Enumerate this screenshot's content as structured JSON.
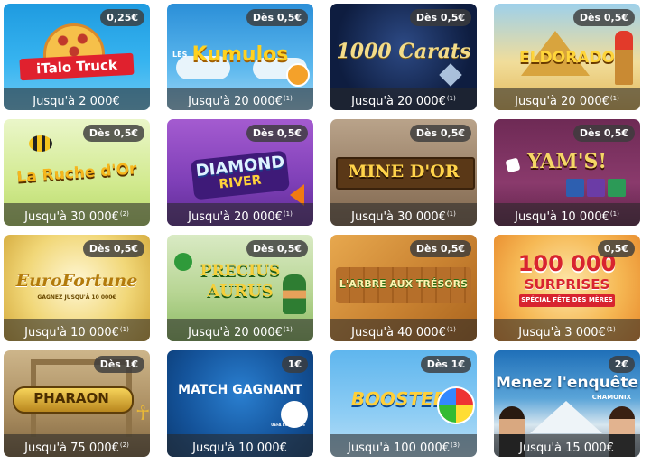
{
  "cards": [
    {
      "name": "Italo Truck",
      "logo": "iTalo Truck",
      "price": "0,25€",
      "max_win": "Jusqu'à 2 000€",
      "note": ""
    },
    {
      "name": "Les Kumulos",
      "logo": "Kumulos",
      "logo_prefix": "LES",
      "price": "Dès 0,5€",
      "max_win": "Jusqu'à 20 000€",
      "note": "(1)"
    },
    {
      "name": "1000 Carats",
      "logo": "1000 Carats",
      "price": "Dès 0,5€",
      "max_win": "Jusqu'à 20 000€",
      "note": "(1)"
    },
    {
      "name": "Eldorado",
      "logo": "ELDORADO",
      "price": "Dès 0,5€",
      "max_win": "Jusqu'à 20 000€",
      "note": "(1)"
    },
    {
      "name": "La Ruche d'Or",
      "logo": "La Ruche d'Or",
      "price": "Dès 0,5€",
      "max_win": "Jusqu'à 30 000€",
      "note": "(2)"
    },
    {
      "name": "Diamond River",
      "logo": "DIAMOND",
      "logo_sub": "RIVER",
      "price": "Dès 0,5€",
      "max_win": "Jusqu'à 20 000€",
      "note": "(1)"
    },
    {
      "name": "Mine d'Or",
      "logo": "MINE D'OR",
      "price": "Dès 0,5€",
      "max_win": "Jusqu'à 30 000€",
      "note": "(1)"
    },
    {
      "name": "Yam's",
      "logo": "YAM'S!",
      "price": "Dès 0,5€",
      "max_win": "Jusqu'à 10 000€",
      "note": "(1)"
    },
    {
      "name": "EuroFortune",
      "logo": "EuroFortune",
      "logo_sub": "GAGNEZ JUSQU'À 10 000€",
      "price": "Dès 0,5€",
      "max_win": "Jusqu'à 10 000€",
      "note": "(1)"
    },
    {
      "name": "Precius Aurus",
      "logo": "PRECIUS",
      "logo_sub": "AURUS",
      "price": "Dès 0,5€",
      "max_win": "Jusqu'à 20 000€",
      "note": "(1)"
    },
    {
      "name": "L'Arbre aux Trésors",
      "logo": "L'ARBRE AUX TRÉSORS",
      "price": "Dès 0,5€",
      "max_win": "Jusqu'à 40 000€",
      "note": "(1)"
    },
    {
      "name": "100 000 Surprises",
      "logo": "100 000",
      "logo_sub": "SURPRISES",
      "logo_tag": "SPÉCIAL FÊTE DES MÈRES",
      "price": "0,5€",
      "max_win": "Jusqu'à 3 000€",
      "note": "(1)"
    },
    {
      "name": "Pharaon",
      "logo": "PHARAON",
      "price": "Dès 1€",
      "max_win": "Jusqu'à 75 000€",
      "note": "(2)"
    },
    {
      "name": "Match Gagnant",
      "logo": "MATCH GAGNANT",
      "logo_sub": "UEFA EURO 2016",
      "price": "1€",
      "max_win": "Jusqu'à 10 000€",
      "note": ""
    },
    {
      "name": "Booster",
      "logo": "BOOSTER",
      "price": "Dès 1€",
      "max_win": "Jusqu'à 100 000€",
      "note": "(3)"
    },
    {
      "name": "Menez l'enquête",
      "logo": "Menez l'enquête",
      "logo_sub": "CHAMONIX",
      "price": "2€",
      "max_win": "Jusqu'à 15 000€",
      "note": ""
    }
  ]
}
